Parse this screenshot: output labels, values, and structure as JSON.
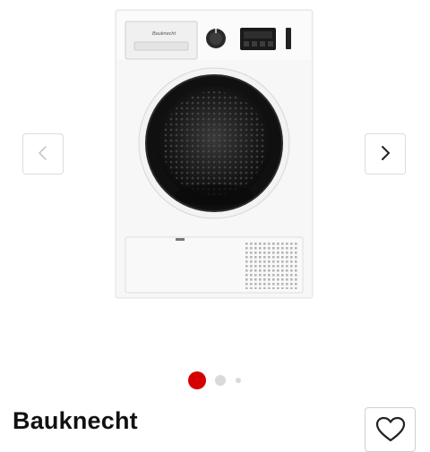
{
  "product": {
    "brand": "Bauknecht",
    "image_alt": "Bauknecht heat pump dryer, white, front view",
    "logo_text": "Bauknecht"
  },
  "carousel": {
    "prev_icon": "chevron-left-icon",
    "next_icon": "chevron-right-icon",
    "active_index": 0,
    "total_dots": 3
  },
  "wishlist": {
    "icon": "heart-outline-icon"
  },
  "colors": {
    "accent": "#d40000",
    "dot_inactive": "#d9d9d9",
    "border": "#dcdcdc",
    "text": "#111111"
  }
}
